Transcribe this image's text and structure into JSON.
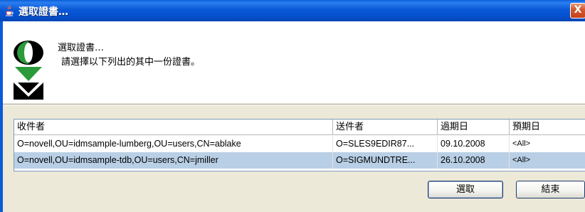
{
  "window": {
    "title": "選取證書…",
    "icon": "java-cup-icon",
    "close_label": "X"
  },
  "header": {
    "title": "選取證書…",
    "message": "請選擇以下列出的其中一份證書。",
    "logo": "novell-identity-logo"
  },
  "table": {
    "columns": [
      "收件者",
      "送件者",
      "過期日",
      "預期日"
    ],
    "rows": [
      {
        "recipient": "O=novell,OU=idmsample-lumberg,OU=users,CN=ablake",
        "sender": "O=SLES9EDIR87...",
        "expires": "09.10.2008",
        "expected": "<All>",
        "selected": false
      },
      {
        "recipient": "O=novell,OU=idmsample-tdb,OU=users,CN=jmiller",
        "sender": "O=SIGMUNDTRE...",
        "expires": "26.10.2008",
        "expected": "<All>",
        "selected": true
      }
    ]
  },
  "buttons": {
    "select_label": "選取",
    "close_label": "結束"
  },
  "colors": {
    "titlebar": "#0a58d6",
    "selected_row": "#b8cfe5",
    "close_button": "#d55a2e"
  }
}
